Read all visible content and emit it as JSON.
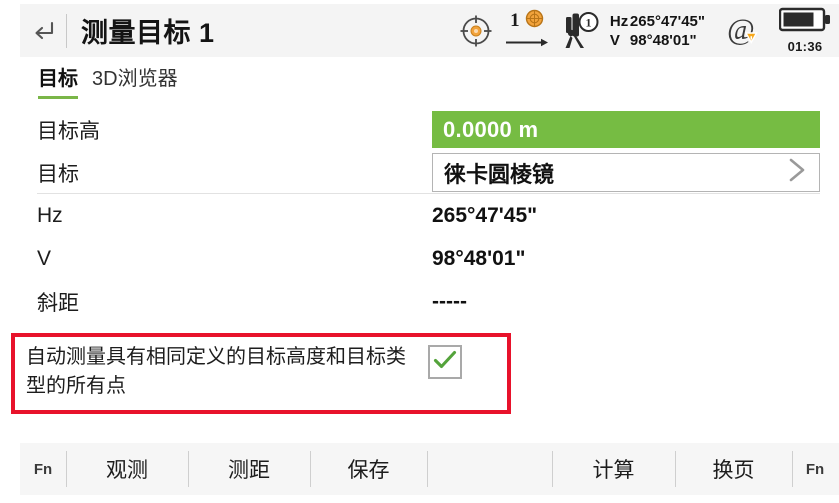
{
  "header": {
    "back_icon": "back-arrow-icon",
    "title": "测量目标 1"
  },
  "status_bar": {
    "target_icon": "crosshair-target-icon",
    "prism_count": "1",
    "prism_icon": "prism-icon",
    "arrow_icon": "arrow-right-icon",
    "station_icon": "total-station-icon",
    "station_badge": "1",
    "hz_label": "Hz",
    "hz_value": "265°47'45\"",
    "v_label": "V",
    "v_value": "98°48'01\"",
    "at_icon": "at-sign-warning-icon",
    "battery_icon": "battery-icon",
    "battery_time": "01:36"
  },
  "tabs": [
    {
      "label": "目标",
      "active": true
    },
    {
      "label": "3D浏览器",
      "active": false
    }
  ],
  "form": {
    "rows": [
      {
        "label": "目标高",
        "value": "0.0000 m",
        "type": "green-field"
      },
      {
        "label": "目标",
        "value": "徕卡圆棱镜",
        "type": "select"
      },
      {
        "label": "Hz",
        "value": "265°47'45\"",
        "type": "text"
      },
      {
        "label": "V",
        "value": "98°48'01\"",
        "type": "text"
      },
      {
        "label": "斜距",
        "value": "-----",
        "type": "text"
      }
    ]
  },
  "auto_measure": {
    "label": "自动测量具有相同定义的目标高度和目标类型的所有点",
    "checked": true,
    "check_icon": "checkmark-icon",
    "highlight_color": "#e8122b"
  },
  "toolbar": {
    "fn_left": "Fn",
    "buttons": [
      {
        "label": "观测"
      },
      {
        "label": "测距"
      },
      {
        "label": "保存"
      },
      {
        "label": ""
      },
      {
        "label": "计算"
      },
      {
        "label": "换页"
      }
    ],
    "fn_right": "Fn"
  },
  "colors": {
    "accent_green": "#76bc43",
    "warning_orange": "#f7a81b",
    "highlight_red": "#e8122b",
    "header_bg": "#f4f4f4",
    "toolbar_bg": "#f6f6f6"
  }
}
